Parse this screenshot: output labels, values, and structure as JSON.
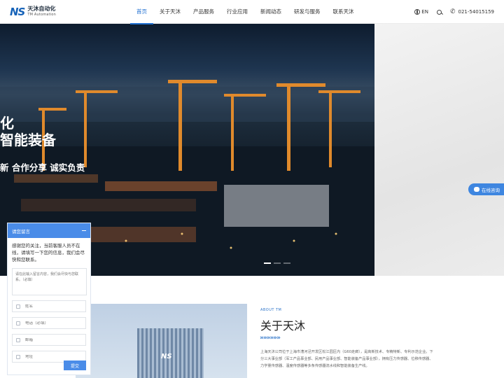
{
  "header": {
    "logo_mark": "NS",
    "logo_cn": "天沐自动化",
    "logo_en": "TM Automation",
    "nav": [
      {
        "label": "首页",
        "active": true
      },
      {
        "label": "关于天沐",
        "active": false
      },
      {
        "label": "产品服务",
        "active": false
      },
      {
        "label": "行业应用",
        "active": false
      },
      {
        "label": "新闻动态",
        "active": false
      },
      {
        "label": "研发与服务",
        "active": false
      },
      {
        "label": "联系天沐",
        "active": false
      }
    ],
    "lang": "EN",
    "phone": "021-54015159",
    "accent_color": "#1f6fd1"
  },
  "hero": {
    "line1": "化",
    "line2": "智能装备",
    "line3": "新  合作分享  诚实负责",
    "chat_tab": "在线咨询"
  },
  "about": {
    "kicker": "ABOUT TM",
    "title": "关于天沐",
    "arrows": "»»»»»»",
    "body": "上海天沐公司位于上海市漕河泾开发区松江园区内（G60走廊），是高新技术、专精特新、专利示范企业。下分三大事业部（军工产品事业部、民用产品事业部、智能装备产品事业部），拥有压力传感器、位移传感器、力学量传感器、温度传感器等多条传感器流水线和智能装备生产线。",
    "building_sign": "NS"
  },
  "message": {
    "title": "请您留言",
    "intro": "感谢您的关注，当前客服人员不在线，请填写一下您的信息，我们会尽快和您联系。",
    "textarea_placeholder": "请在此输入留言内容，我们会尽快与您联系。（必填）",
    "fields": [
      {
        "placeholder": "姓名"
      },
      {
        "placeholder": "电话（必填）"
      },
      {
        "placeholder": "邮箱"
      },
      {
        "placeholder": "地址"
      }
    ],
    "submit": "提交",
    "accent_color": "#4a8ce8"
  }
}
